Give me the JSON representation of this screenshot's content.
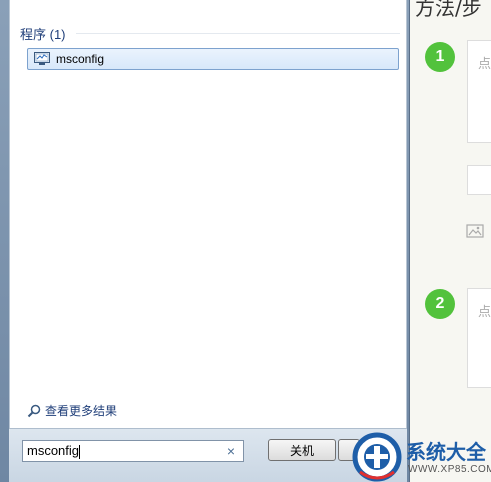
{
  "start_menu": {
    "section_header": "程序 (1)",
    "results": [
      {
        "label": "msconfig",
        "icon": "msconfig-app-icon"
      }
    ],
    "see_more_label": "查看更多结果",
    "search": {
      "value": "msconfig",
      "clear_icon": "×"
    },
    "shutdown_label": "关机"
  },
  "article": {
    "heading": "方法/步",
    "steps": [
      {
        "number": "1",
        "placeholder": "点"
      },
      {
        "number": "2",
        "placeholder": "点"
      }
    ]
  },
  "watermark": {
    "name": "系统大全",
    "url": "WWW.XP85.COM"
  },
  "colors": {
    "step_badge": "#52c23c",
    "selection_border": "#7da2ce",
    "header_text": "#1f3e79",
    "logo_blue": "#1e5ea8"
  }
}
